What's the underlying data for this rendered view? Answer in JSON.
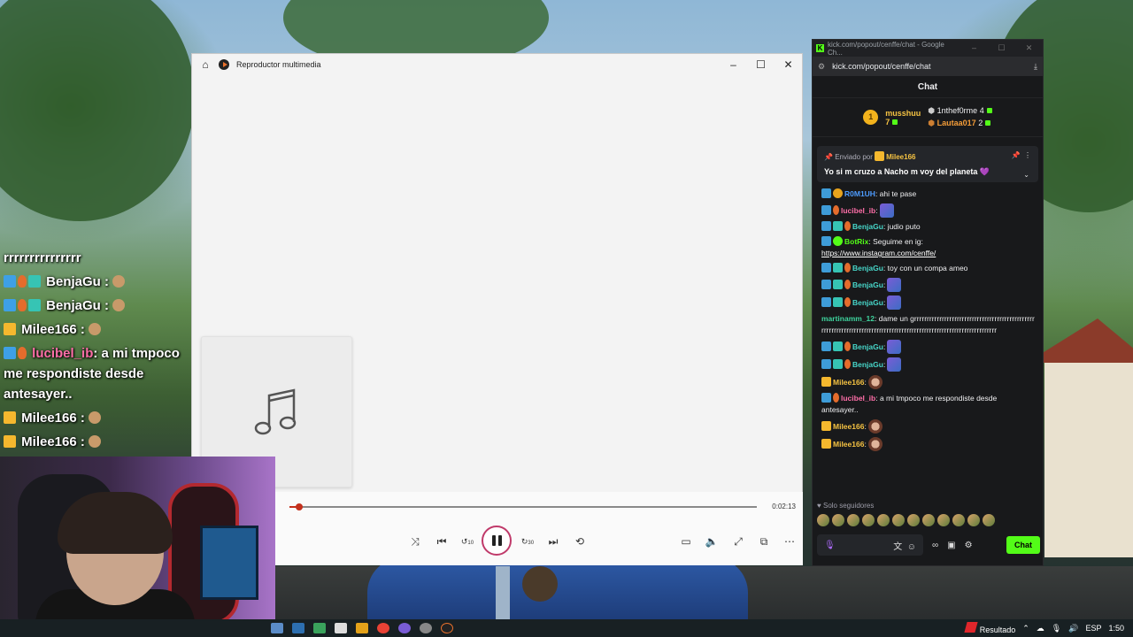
{
  "overlay_chat": {
    "lines": [
      {
        "user": "",
        "text": "rrrrrrrrrrrrrrr"
      },
      {
        "user": "BenjaGu :",
        "text": ""
      },
      {
        "user": "BenjaGu :",
        "text": ""
      },
      {
        "user": "Milee166 :",
        "text": ""
      },
      {
        "user": "lucibel_ib",
        "text": ": a mi tmpoco me respondiste desde antesayer.."
      },
      {
        "user": "Milee166 :",
        "text": ""
      },
      {
        "user": "Milee166 :",
        "text": ""
      }
    ]
  },
  "player": {
    "title": "Reproductor multimedia",
    "time": "0:02:13",
    "progress_fraction": 0.02,
    "icons": {
      "home": "home-icon",
      "minimize": "minimize-icon",
      "maximize": "maximize-icon",
      "close": "close-icon",
      "art": "music-note-icon",
      "shuffle": "shuffle-icon",
      "previous": "previous-icon",
      "rewind": "rewind-10-icon",
      "play_pause": "pause-icon",
      "forward": "forward-30-icon",
      "next": "next-icon",
      "repeat": "repeat-off-icon",
      "miniplayer": "miniplayer-icon",
      "volume": "volume-icon",
      "fullscreen": "fullscreen-icon",
      "cast": "cast-icon",
      "more": "more-icon"
    },
    "rewind_label": "10",
    "forward_label": "30"
  },
  "chat_window": {
    "title": "kick.com/popout/cenffe/chat - Google Ch...",
    "url": "kick.com/popout/cenffe/chat",
    "header": "Chat",
    "leaderboard": {
      "first": {
        "rank": "1",
        "user": "musshuu",
        "count": "7"
      },
      "second": {
        "user": "1nthef0rme",
        "count": "4"
      },
      "third": {
        "user": "Lautaa017",
        "count": "2"
      }
    },
    "pinned": {
      "by_label": "Enviado por",
      "by_user": "Milee166",
      "message": "Yo si m cruzo a Nacho m voy del planeta 💜"
    },
    "messages": [
      {
        "user": "R0M1UH",
        "text": ": ahi te pase"
      },
      {
        "user": "lucibel_ib",
        "text": ":"
      },
      {
        "user": "BenjaGu",
        "text": ": judio puto"
      },
      {
        "user": "BotRix",
        "text": ": Seguime en ig:",
        "link": "https://www.instagram.com/cenffe/"
      },
      {
        "user": "BenjaGu",
        "text": ": toy con un compa ameo"
      },
      {
        "user": "BenjaGu",
        "text": ":"
      },
      {
        "user": "BenjaGu",
        "text": ":"
      },
      {
        "user": "martinamm_12",
        "text": ": dame un grrrrrrrrrrrrrrrrrrrrrrrrrrrrrrrrrrrrrrrrrrrrrrrrrrrrrrrrrrrrrrrrrrrrrrrrrrrrrrrrrrrrrrrrrrrrrrrrrrrrrrrrrrrrrrrrrrrrrr"
      },
      {
        "user": "BenjaGu",
        "text": ":"
      },
      {
        "user": "BenjaGu",
        "text": ":"
      },
      {
        "user": "Milee166",
        "text": ":"
      },
      {
        "user": "lucibel_ib",
        "text": ": a mi tmpoco me respondiste desde antesayer.."
      },
      {
        "user": "Milee166",
        "text": ":"
      },
      {
        "user": "Milee166",
        "text": ":"
      }
    ],
    "followers_only": "Solo seguidores",
    "send_label": "Chat"
  },
  "taskbar": {
    "result_label": "Resultado",
    "language": "ESP",
    "clock": "1:50"
  },
  "colors": {
    "kick_green": "#53fc18",
    "seek_red": "#c4301c"
  }
}
